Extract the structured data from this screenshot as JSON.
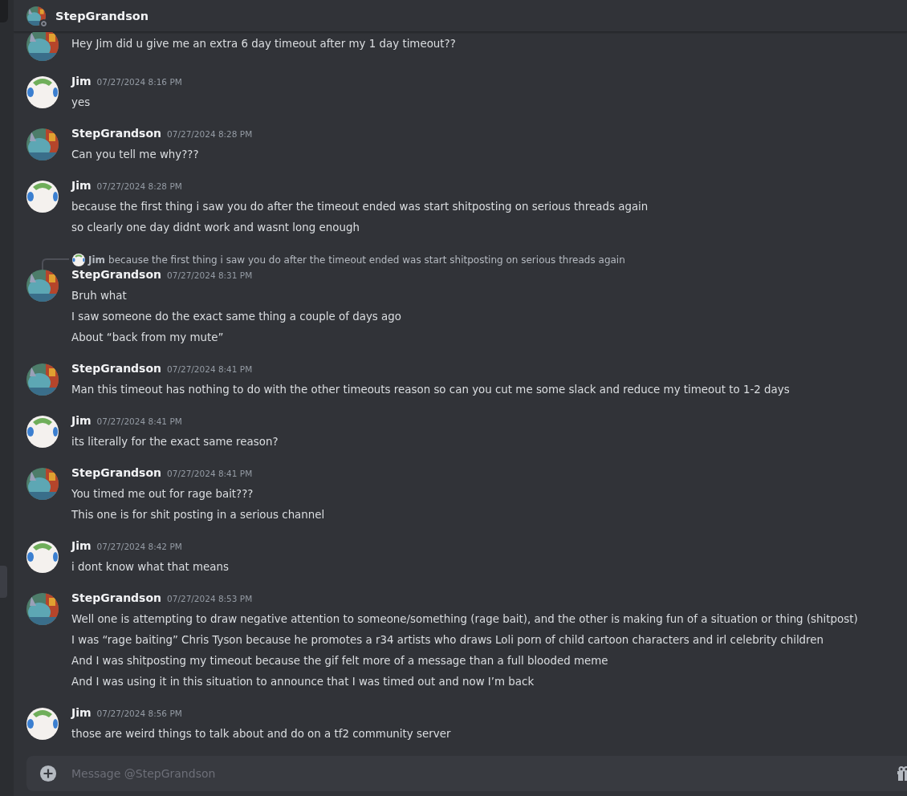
{
  "header": {
    "title": "StepGrandson",
    "online": false
  },
  "messages": [
    {
      "kind": "step",
      "lines": [
        "Hey Jim did u give me an extra 6 day timeout after my 1 day timeout??"
      ]
    },
    {
      "author": "Jim",
      "kind": "jim",
      "time": "07/27/2024 8:16 PM",
      "lines": [
        "yes"
      ]
    },
    {
      "author": "StepGrandson",
      "kind": "step",
      "time": "07/27/2024 8:28 PM",
      "lines": [
        "Can you tell me why???"
      ]
    },
    {
      "author": "Jim",
      "kind": "jim",
      "time": "07/27/2024 8:28 PM",
      "lines": [
        "because the first thing i saw you do after the timeout ended was start shitposting on serious threads again",
        "so clearly one day didnt work and wasnt long enough"
      ]
    },
    {
      "author": "StepGrandson",
      "kind": "step",
      "time": "07/27/2024 8:31 PM",
      "reply": {
        "author": "Jim",
        "kind": "jim",
        "text": "because the first thing i saw you do after the timeout ended was start shitposting on serious threads again"
      },
      "lines": [
        "Bruh what",
        "I saw someone do the exact same thing a couple of days ago",
        "About “back from my mute”"
      ]
    },
    {
      "author": "StepGrandson",
      "kind": "step",
      "time": "07/27/2024 8:41 PM",
      "lines": [
        "Man this timeout has nothing to do with the other timeouts reason so can you cut me some slack and reduce my timeout to 1-2 days"
      ]
    },
    {
      "author": "Jim",
      "kind": "jim",
      "time": "07/27/2024 8:41 PM",
      "lines": [
        "its literally for the exact same reason?"
      ]
    },
    {
      "author": "StepGrandson",
      "kind": "step",
      "time": "07/27/2024 8:41 PM",
      "lines": [
        "You timed me out for rage bait???",
        "This one is for shit posting in a serious channel"
      ]
    },
    {
      "author": "Jim",
      "kind": "jim",
      "time": "07/27/2024 8:42 PM",
      "lines": [
        "i dont know what that means"
      ]
    },
    {
      "author": "StepGrandson",
      "kind": "step",
      "time": "07/27/2024 8:53 PM",
      "lines": [
        "Well one is attempting to draw negative attention to someone/something (rage bait), and the other is making fun of a situation or thing (shitpost)",
        "I was “rage baiting” Chris Tyson because he promotes a r34 artists who draws Loli porn of child cartoon characters and irl celebrity children",
        "And I was shitposting my timeout because the gif felt more of a message than a full blooded meme",
        "And I was using it in this situation to announce that I was timed out and now I’m back"
      ]
    },
    {
      "author": "Jim",
      "kind": "jim",
      "time": "07/27/2024 8:56 PM",
      "lines": [
        "those are weird things to talk about and do on a tf2 community server"
      ]
    }
  ],
  "composer": {
    "placeholder": "Message @StepGrandson"
  }
}
